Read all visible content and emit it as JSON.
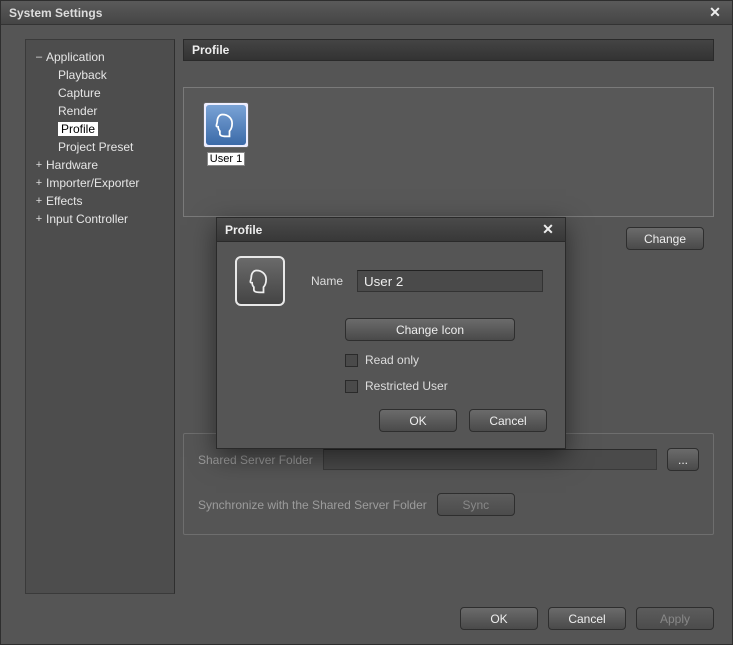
{
  "window": {
    "title": "System Settings"
  },
  "sidebar": {
    "items": [
      {
        "label": "Application",
        "toggle": "–",
        "expanded": true
      },
      {
        "label": "Hardware",
        "toggle": "+"
      },
      {
        "label": "Importer/Exporter",
        "toggle": "+"
      },
      {
        "label": "Effects",
        "toggle": "+"
      },
      {
        "label": "Input Controller",
        "toggle": "+"
      }
    ],
    "application_children": [
      {
        "label": "Playback"
      },
      {
        "label": "Capture"
      },
      {
        "label": "Render"
      },
      {
        "label": "Profile",
        "selected": true
      },
      {
        "label": "Project Preset"
      }
    ]
  },
  "main": {
    "section_title": "Profile",
    "profile_tile": {
      "caption": "User 1"
    },
    "change_label": "Change",
    "shared": {
      "folder_label": "Shared Server Folder",
      "folder_value": "",
      "browse_label": "...",
      "sync_text": "Synchronize with the Shared Server Folder",
      "sync_label": "Sync"
    }
  },
  "dialog": {
    "title": "Profile",
    "name_label": "Name",
    "name_value": "User 2",
    "change_icon_label": "Change Icon",
    "read_only_label": "Read only",
    "restricted_label": "Restricted User",
    "ok_label": "OK",
    "cancel_label": "Cancel"
  },
  "footer": {
    "ok_label": "OK",
    "cancel_label": "Cancel",
    "apply_label": "Apply"
  }
}
